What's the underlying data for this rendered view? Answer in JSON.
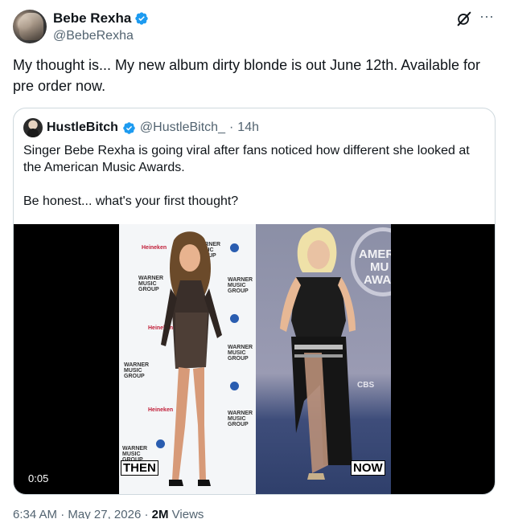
{
  "author": {
    "display_name": "Bebe Rexha",
    "handle": "@BebeRexha",
    "verified_color": "#1d9bf0"
  },
  "tweet": {
    "text": "My thought is... My new album dirty blonde is out June 12th. Available for pre order now."
  },
  "quoted": {
    "display_name": "HustleBitch",
    "handle": "@HustleBitch_",
    "separator": "·",
    "time": "14h",
    "text_line1": "Singer Bebe Rexha is going viral after fans noticed how different she looked at the American Music Awards.",
    "text_line2": "Be honest... what's your first thought?",
    "media": {
      "left_label": "THEN",
      "right_label": "NOW",
      "duration": "0:05",
      "backdrop_left_words": [
        "Heineken",
        "WARNER MUSIC GROUP"
      ],
      "backdrop_right_words": [
        "AMER",
        "MU",
        "AWA",
        "CBS"
      ]
    }
  },
  "footer": {
    "time": "6:34 AM",
    "sep1": "·",
    "date": "May 27, 2026",
    "sep2": "·",
    "views_count": "2M",
    "views_label": "Views"
  },
  "icons": {
    "grok": "grok-icon",
    "more": "more-icon"
  }
}
